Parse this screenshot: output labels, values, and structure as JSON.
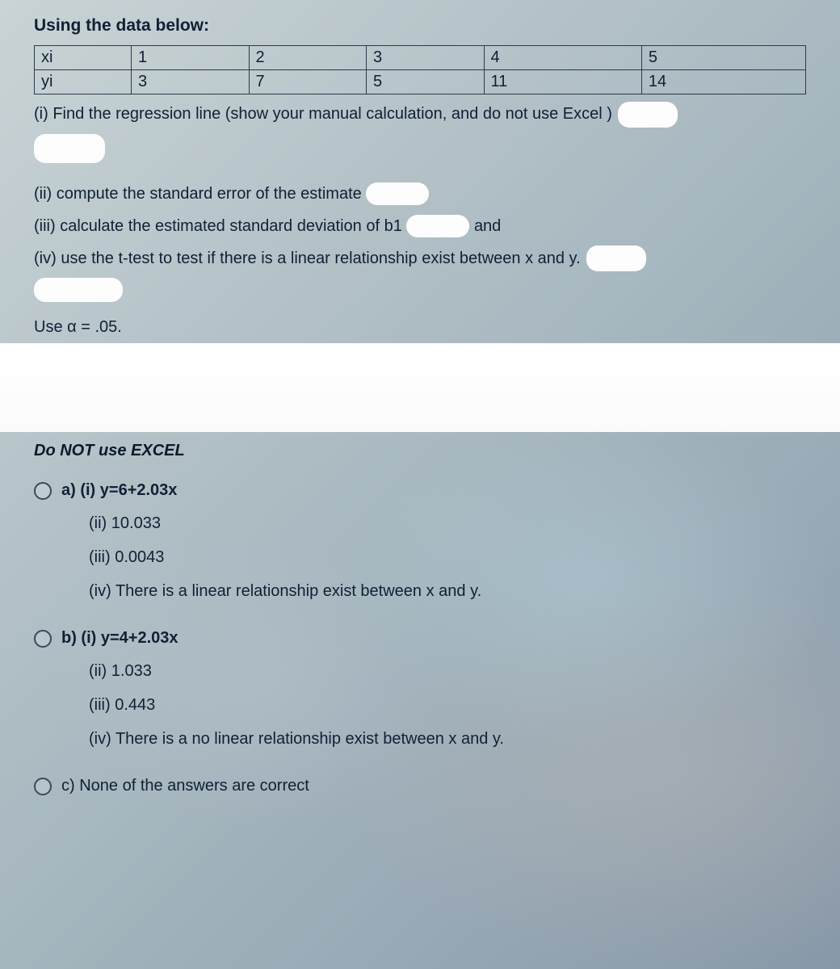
{
  "intro": "Using the data below:",
  "table": {
    "rows": [
      {
        "label": "xi",
        "c1": "1",
        "c2": "2",
        "c3": "3",
        "c4": "4",
        "c5": "5"
      },
      {
        "label": "yi",
        "c1": "3",
        "c2": "7",
        "c3": "5",
        "c4": "11",
        "c5": "14"
      }
    ]
  },
  "prompts": {
    "p1": "(i) Find the regression line (show your manual calculation, and do not use Excel )",
    "p2": "(ii) compute the standard error of the estimate",
    "p3a": "(iii) calculate the estimated standard deviation of b1",
    "p3b": "and",
    "p4": "(iv) use the t-test to test if there is a linear relationship exist between x and y."
  },
  "alpha": "Use α = .05.",
  "noexcel": "Do NOT use EXCEL",
  "options": {
    "a": {
      "head": "a) (i) y=6+2.03x",
      "ii": "(ii) 10.033",
      "iii": "(iii) 0.0043",
      "iv": "(iv) There is a linear relationship exist between x and y."
    },
    "b": {
      "head": "b) (i) y=4+2.03x",
      "ii": "(ii) 1.033",
      "iii": "(iii) 0.443",
      "iv": "(iv) There is a no linear relationship exist between x and y."
    },
    "c": {
      "head": "c) None of the answers are correct"
    }
  }
}
